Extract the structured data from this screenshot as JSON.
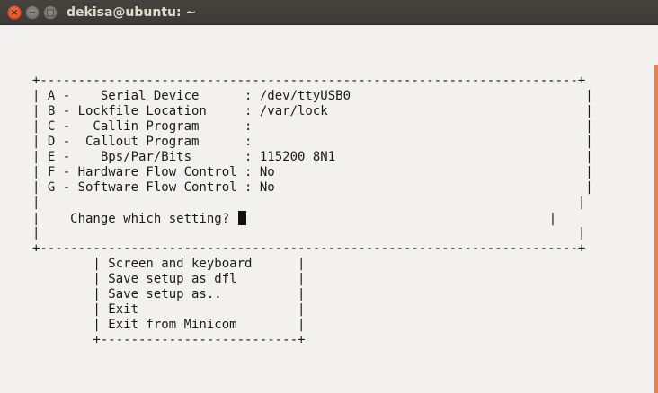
{
  "window": {
    "title": "dekisa@ubuntu: ~",
    "close_glyph": "×",
    "min_glyph": "−",
    "max_glyph": "□"
  },
  "config_box": {
    "border_top": "+-----------------------------------------------------------------------+",
    "border_bottom": "+-----------------------------------------------------------------------+",
    "rows": [
      "| A -    Serial Device      : /dev/ttyUSB0                               |",
      "| B - Lockfile Location     : /var/lock                                  |",
      "| C -   Callin Program      :                                            |",
      "| D -  Callout Program      :                                            |",
      "| E -    Bps/Par/Bits       : 115200 8N1                                 |",
      "| F - Hardware Flow Control : No                                         |",
      "| G - Software Flow Control : No                                         |",
      "|                                                                       |"
    ],
    "prompt_prefix": "|    Change which setting? ",
    "prompt_suffix": "                                        |",
    "row_after_prompt": "|                                                                       |"
  },
  "menu": {
    "items": [
      "        | Screen and keyboard      |",
      "        | Save setup as dfl        |",
      "        | Save setup as..          |",
      "        | Exit                     |",
      "        | Exit from Minicom        |"
    ],
    "border_bottom": "        +--------------------------+"
  },
  "colors": {
    "close_button": "#e0552b",
    "titlebar": "#3c3b37",
    "background": "#f2f1f0",
    "scrollbar": "#e8834f"
  }
}
